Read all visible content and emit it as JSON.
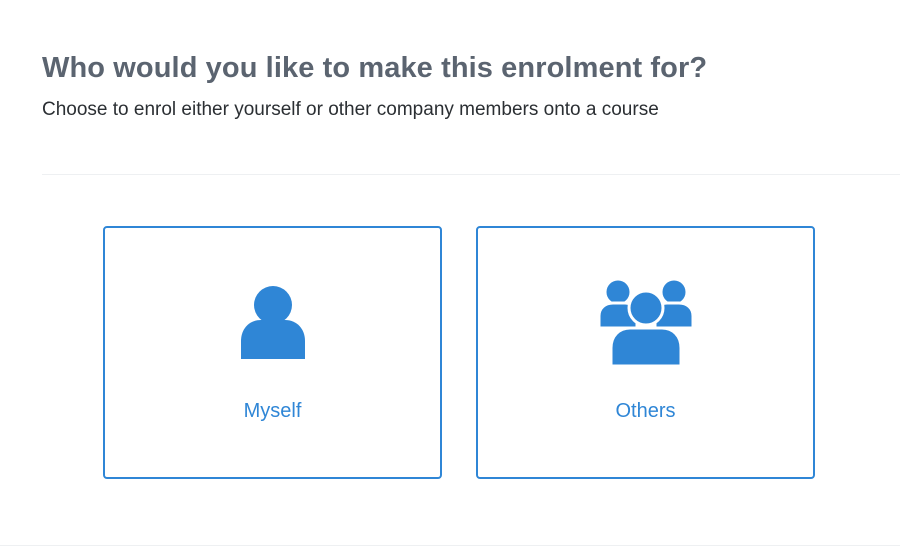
{
  "header": {
    "title": "Who would you like to make this enrolment for?",
    "subtitle": "Choose to enrol either yourself or other company members onto a course"
  },
  "options": [
    {
      "label": "Myself",
      "icon": "user-icon"
    },
    {
      "label": "Others",
      "icon": "users-group-icon"
    }
  ],
  "colors": {
    "accent": "#2f86d6",
    "heading": "#5b6470",
    "text": "#2b2f33"
  }
}
